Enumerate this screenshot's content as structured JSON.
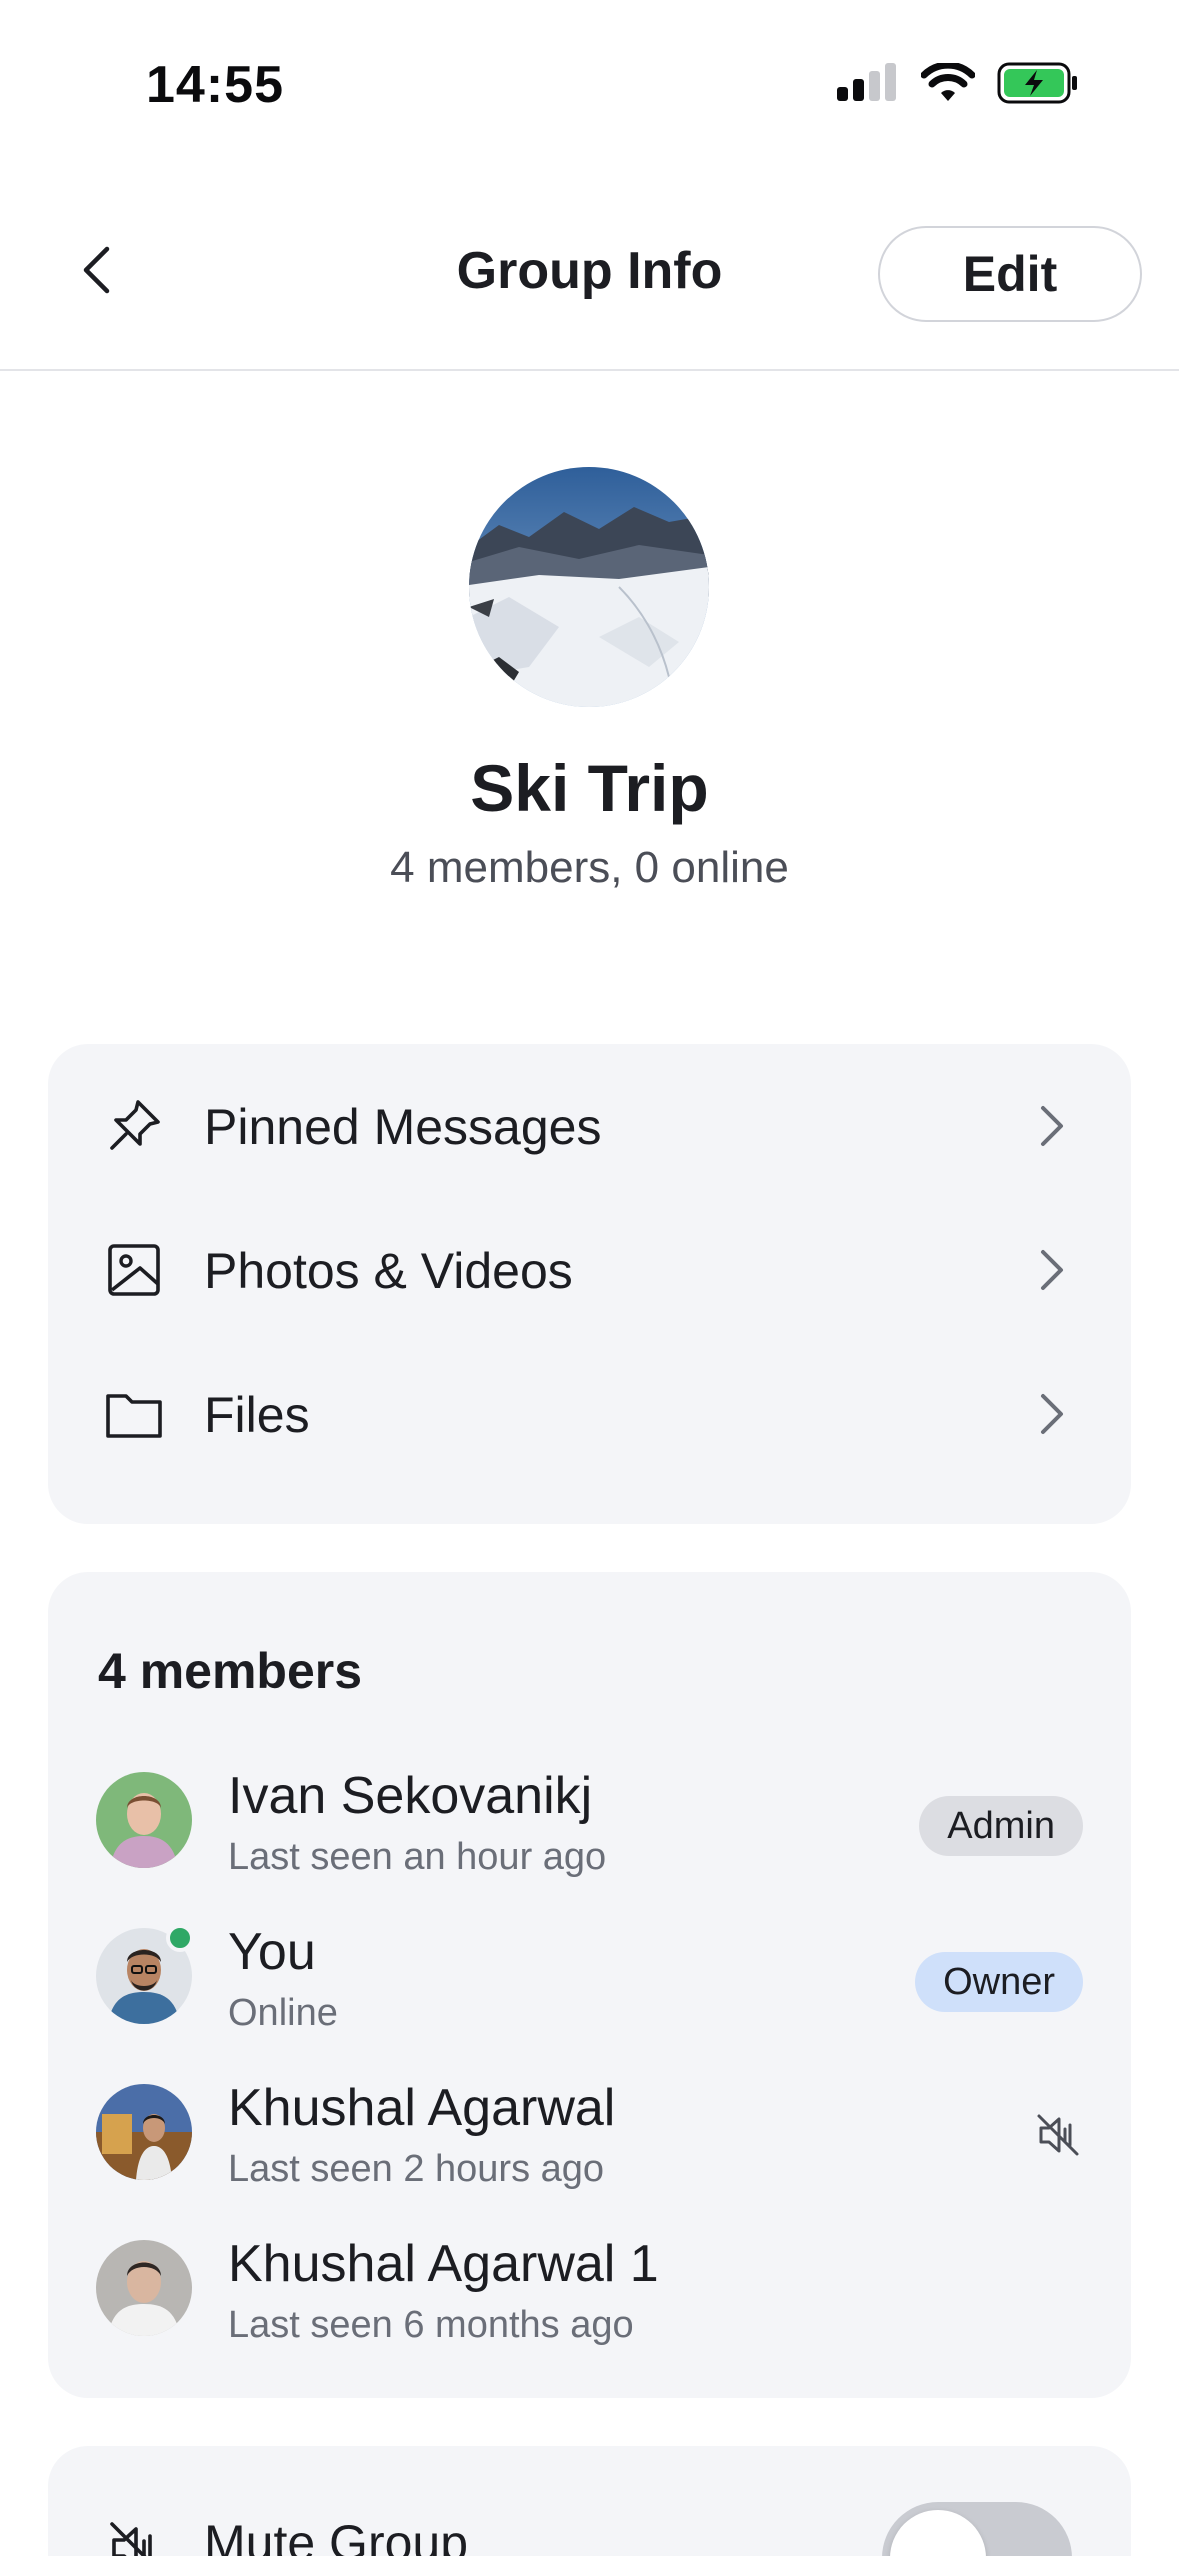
{
  "status_bar": {
    "time": "14:55",
    "battery_color": "#34c759"
  },
  "nav": {
    "title": "Group Info",
    "edit_label": "Edit"
  },
  "group": {
    "name": "Ski Trip",
    "subtitle": "4 members, 0 online"
  },
  "menu": {
    "items": [
      {
        "label": "Pinned Messages",
        "icon": "pin-icon"
      },
      {
        "label": "Photos & Videos",
        "icon": "image-icon"
      },
      {
        "label": "Files",
        "icon": "folder-icon"
      }
    ]
  },
  "members": {
    "title": "4 members",
    "list": [
      {
        "name": "Ivan Sekovanikj",
        "status": "Last seen an hour ago",
        "badge": "Admin"
      },
      {
        "name": "You",
        "status": "Online",
        "badge": "Owner",
        "online": true
      },
      {
        "name": "Khushal Agarwal",
        "status": "Last seen 2 hours ago",
        "muted": true
      },
      {
        "name": "Khushal Agarwal 1",
        "status": "Last seen 6 months ago"
      }
    ]
  },
  "mute": {
    "label": "Mute Group",
    "enabled": false
  },
  "colors": {
    "online": "#2fa866",
    "owner_badge": "#cfe0fa",
    "admin_badge": "#dcdde2",
    "card_bg": "#f4f5f8"
  }
}
